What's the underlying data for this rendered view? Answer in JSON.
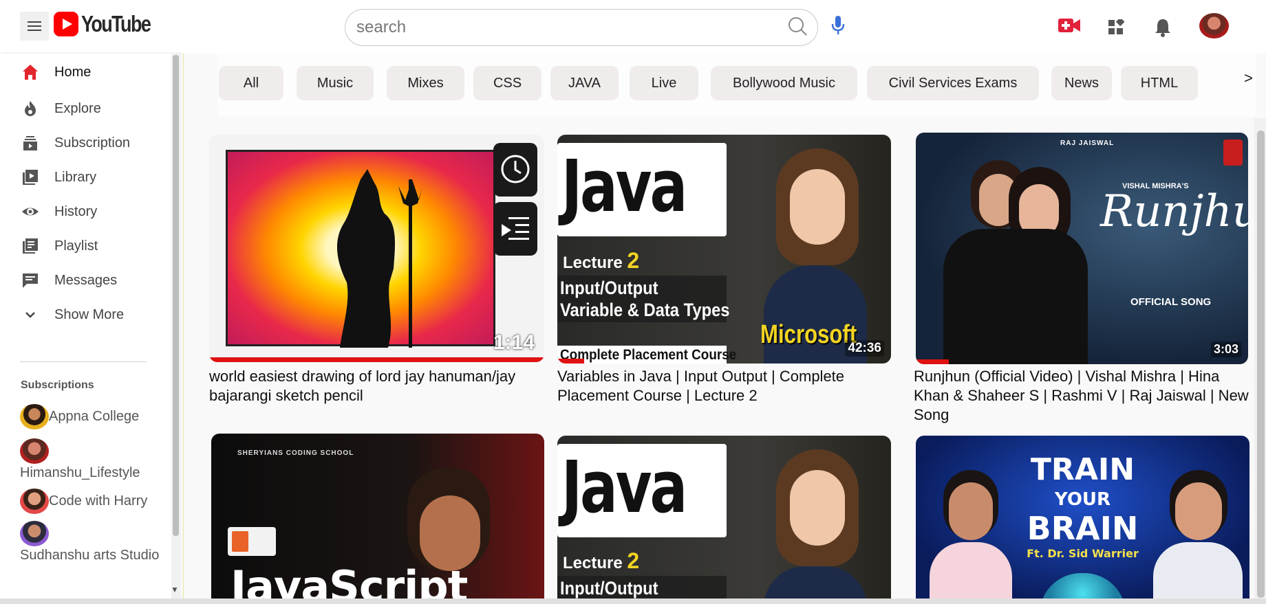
{
  "header": {
    "logo_text": "YouTube",
    "search_placeholder": "search",
    "icons": [
      "menu-icon",
      "search-icon",
      "mic-icon",
      "create-video-icon",
      "apps-icon",
      "notifications-icon"
    ]
  },
  "sidebar": {
    "items": [
      {
        "label": "Home",
        "icon": "home-icon",
        "active": true
      },
      {
        "label": "Explore",
        "icon": "explore-icon"
      },
      {
        "label": "Subscription",
        "icon": "subscription-icon"
      },
      {
        "label": "Library",
        "icon": "library-icon"
      },
      {
        "label": "History",
        "icon": "history-icon"
      },
      {
        "label": "Playlist",
        "icon": "playlist-icon"
      },
      {
        "label": "Messages",
        "icon": "messages-icon"
      },
      {
        "label": "Show More",
        "icon": "chevron-down-icon"
      }
    ],
    "subscriptions_title": "Subscriptions",
    "subscriptions": [
      {
        "name": "Appna College"
      },
      {
        "name": "Himanshu_Lifestyle"
      },
      {
        "name": "Code with Harry"
      },
      {
        "name": "Sudhanshu arts Studio"
      }
    ]
  },
  "chips": [
    "All",
    "Music",
    "Mixes",
    "CSS",
    "JAVA",
    "Live",
    "Bollywood Music",
    "Civil Services Exams",
    "News",
    "HTML"
  ],
  "chips_next": ">",
  "videos": [
    {
      "title": "world easiest drawing of lord jay hanuman/jay bajarangi sketch pencil",
      "duration": "1:14",
      "progress": 1.0
    },
    {
      "title": "Variables in Java | Input Output | Complete Placement Course | Lecture 2",
      "duration": "42:36",
      "progress": 0.08,
      "thumb_text": {
        "big": "Java",
        "lecture": "Lecture",
        "lecture_num": "2",
        "line1": "Input/Output",
        "line2": "Variable & Data Types",
        "brand": "Microsoft",
        "footer": "Complete Placement Course"
      }
    },
    {
      "title": "Runjhun (Official Video) | Vishal Mishra | Hina Khan & Shaheer S | Rashmi V | Raj Jaiswal | New Song",
      "duration": "3:03",
      "progress": 0.1,
      "thumb_text": {
        "top": "RAJ JAISWAL",
        "artist": "VISHAL MISHRA'S",
        "script": "Runjhun",
        "song": "OFFICIAL SONG"
      }
    },
    {
      "thumb_text": {
        "school": "SHERYIANS CODING SCHOOL",
        "big": "JavaScript"
      }
    },
    {
      "thumb_text": {
        "big": "Java",
        "lecture": "Lecture",
        "lecture_num": "2",
        "line1": "Input/Output"
      }
    },
    {
      "thumb_text": {
        "line1": "TRAIN",
        "line2": "YOUR",
        "line3": "BRAIN",
        "sub": "Ft. Dr. Sid Warrier"
      }
    }
  ]
}
